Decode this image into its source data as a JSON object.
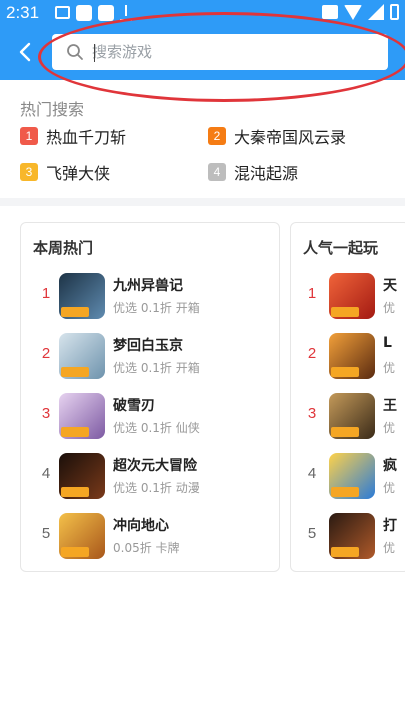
{
  "status_bar": {
    "time": "2:31"
  },
  "search": {
    "placeholder": "搜索游戏"
  },
  "hot_search": {
    "title": "热门搜索",
    "items": [
      {
        "rank": "1",
        "label": "热血千刀斩",
        "color": "#f05a4a"
      },
      {
        "rank": "2",
        "label": "大秦帝国风云录",
        "color": "#f57c14"
      },
      {
        "rank": "3",
        "label": "飞弹大侠",
        "color": "#f8b72a"
      },
      {
        "rank": "4",
        "label": "混沌起源",
        "color": "#bdbdbd"
      }
    ]
  },
  "weekly_hot": {
    "title": "本周热门",
    "items": [
      {
        "rank": "1",
        "name": "九州异兽记",
        "meta": "优选 0.1折 开箱",
        "rank_color": "#e0353a",
        "thumb_color": "#3b5d7a"
      },
      {
        "rank": "2",
        "name": "梦回白玉京",
        "meta": "优选 0.1折 开箱",
        "rank_color": "#e0353a",
        "thumb_color": "#8fb3c8"
      },
      {
        "rank": "3",
        "name": "破雪刃",
        "meta": "优选 0.1折 仙侠",
        "rank_color": "#e0353a",
        "thumb_color": "#b08bc7"
      },
      {
        "rank": "4",
        "name": "超次元大冒险",
        "meta": "优选 0.1折 动漫",
        "rank_color": "#666666",
        "thumb_color": "#2b1b12"
      },
      {
        "rank": "5",
        "name": "冲向地心",
        "meta": "0.05折 卡牌",
        "rank_color": "#666666",
        "thumb_color": "#c8871e"
      }
    ]
  },
  "popular": {
    "title": "人气一起玩",
    "items": [
      {
        "rank": "1",
        "name": "天",
        "meta": "优",
        "rank_color": "#e0353a",
        "thumb_color": "#d8332a"
      },
      {
        "rank": "2",
        "name": "L",
        "meta": "优",
        "rank_color": "#e0353a",
        "thumb_color": "#a3521a"
      },
      {
        "rank": "3",
        "name": "王",
        "meta": "优",
        "rank_color": "#e0353a",
        "thumb_color": "#6b4a2a"
      },
      {
        "rank": "4",
        "name": "疯",
        "meta": "优",
        "rank_color": "#666666",
        "thumb_color": "#e2a62a"
      },
      {
        "rank": "5",
        "name": "打",
        "meta": "优",
        "rank_color": "#666666",
        "thumb_color": "#3a2a1e"
      }
    ]
  }
}
